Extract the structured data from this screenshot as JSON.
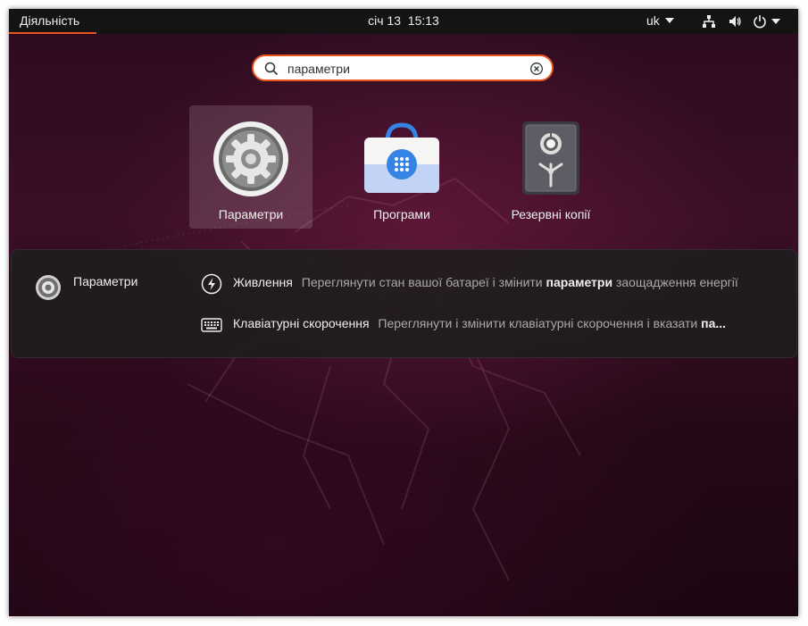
{
  "topbar": {
    "activities": "Діяльність",
    "date": "січ 13",
    "time": "15:13",
    "language": "uk",
    "icons": [
      "network-icon",
      "volume-icon",
      "power-icon",
      "system-menu-arrow-icon"
    ]
  },
  "search": {
    "value": "параметри",
    "icons": [
      "search-icon",
      "clear-icon"
    ]
  },
  "apps": [
    {
      "label": "Параметри",
      "icon": "settings-gear-icon",
      "selected": true
    },
    {
      "label": "Програми",
      "icon": "software-store-bag-icon",
      "selected": false
    },
    {
      "label": "Резервні копії",
      "icon": "backup-safe-icon",
      "selected": false
    }
  ],
  "results": {
    "provider": "Параметри",
    "items": [
      {
        "icon": "power-bolt-icon",
        "title": "Живлення",
        "desc_before": "Переглянути стан вашої батареї і змінити",
        "desc_bold": "параметри",
        "desc_after": "заощадження енергії"
      },
      {
        "icon": "keyboard-icon",
        "title": "Клавіатурні скорочення",
        "desc_before": "Переглянути і змінити клавіатурні скорочення і вказати",
        "desc_bold": "па...",
        "desc_after": ""
      }
    ]
  },
  "colors": {
    "accent": "#e95420",
    "topbar": "#141414",
    "store_blue": "#3584e4"
  }
}
